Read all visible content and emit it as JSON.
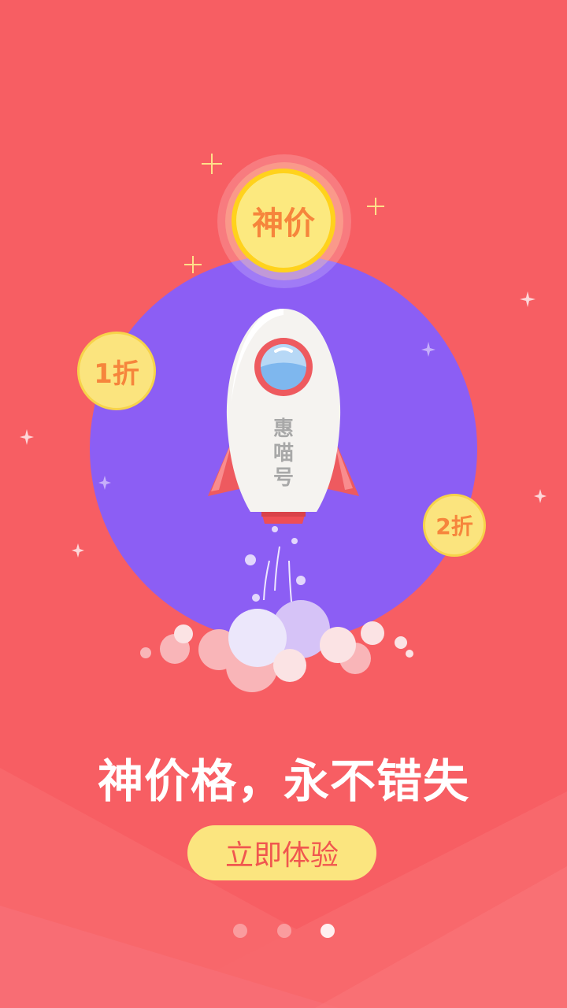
{
  "coins": {
    "main": "神价",
    "left": "1折",
    "right": "2折"
  },
  "rocket": {
    "label_lines": [
      "惠",
      "喵",
      "号"
    ]
  },
  "headline": "神价格，永不错失",
  "cta_label": "立即体验",
  "pager": {
    "count": 3,
    "active_index": 3
  },
  "colors": {
    "background": "#f75e63",
    "planet": "#8c5ef4",
    "coin_fill": "#fbe47e",
    "coin_text": "#f6853c",
    "cta_fill": "#fbe57f",
    "cta_text": "#f0574f"
  }
}
